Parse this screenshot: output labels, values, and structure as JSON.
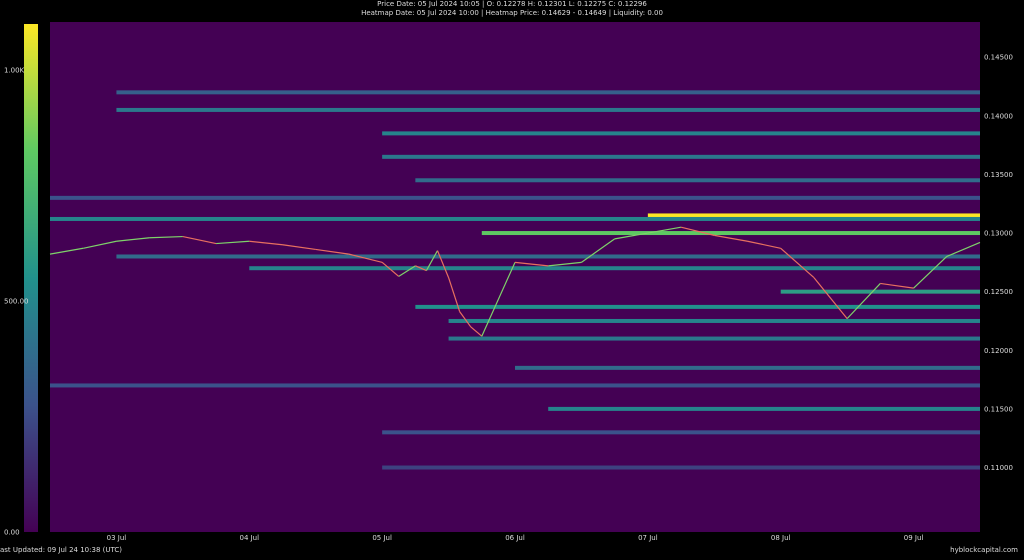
{
  "header": {
    "price_line": "Price Date: 05 Jul 2024 10:05 | O: 0.12278 H: 0.12301 L: 0.12275 C: 0.12296",
    "heatmap_line": "Heatmap Date: 05 Jul 2024 10:00 | Heatmap Price: 0.14629 - 0.14649 | Liquidity: 0.00"
  },
  "footer": {
    "last_updated": "ast Updated: 09 Jul 24 10:38 (UTC)",
    "brand": "hyblockcapital.com"
  },
  "colors": {
    "background": "#000000",
    "heat_low": "#440154",
    "heat_mid": "#21918c",
    "heat_high": "#fde725",
    "price_up": "#7ed36a",
    "price_down": "#e8705f"
  },
  "chart_data": {
    "type": "heatmap",
    "title": "",
    "colorbar": {
      "min": 0,
      "max": 1100,
      "tick_labels": [
        "1.00K",
        "500.00",
        "0.00"
      ],
      "tick_values": [
        1000,
        500,
        0
      ]
    },
    "x_tick_labels": [
      "03 Jul",
      "04 Jul",
      "05 Jul",
      "06 Jul",
      "07 Jul",
      "08 Jul",
      "09 Jul"
    ],
    "x_range": [
      "02 Jul 12:00",
      "09 Jul 12:00"
    ],
    "y_range": [
      0.1045,
      0.148
    ],
    "y_tick_labels": [
      "0.14500",
      "0.14000",
      "0.13500",
      "0.13000",
      "0.12500",
      "0.12000",
      "0.11500",
      "0.11000"
    ],
    "y_tick_values": [
      0.145,
      0.14,
      0.135,
      0.13,
      0.125,
      0.12,
      0.115,
      0.11
    ],
    "price_series": {
      "name": "Price",
      "x": [
        "02 Jul 12:00",
        "02 Jul 18:00",
        "03 Jul 00:00",
        "03 Jul 06:00",
        "03 Jul 12:00",
        "03 Jul 18:00",
        "04 Jul 00:00",
        "04 Jul 06:00",
        "04 Jul 12:00",
        "04 Jul 18:00",
        "05 Jul 00:00",
        "05 Jul 03:00",
        "05 Jul 06:00",
        "05 Jul 08:00",
        "05 Jul 10:00",
        "05 Jul 12:00",
        "05 Jul 14:00",
        "05 Jul 16:00",
        "05 Jul 18:00",
        "06 Jul 00:00",
        "06 Jul 06:00",
        "06 Jul 12:00",
        "06 Jul 18:00",
        "07 Jul 00:00",
        "07 Jul 06:00",
        "07 Jul 12:00",
        "07 Jul 18:00",
        "08 Jul 00:00",
        "08 Jul 06:00",
        "08 Jul 12:00",
        "08 Jul 18:00",
        "09 Jul 00:00",
        "09 Jul 06:00",
        "09 Jul 12:00"
      ],
      "y": [
        0.1282,
        0.1287,
        0.1293,
        0.1296,
        0.1297,
        0.1291,
        0.1293,
        0.129,
        0.1286,
        0.1282,
        0.1275,
        0.1263,
        0.1272,
        0.1268,
        0.1285,
        0.1262,
        0.1233,
        0.122,
        0.1212,
        0.1275,
        0.1272,
        0.1275,
        0.1295,
        0.13,
        0.1305,
        0.1298,
        0.1293,
        0.1287,
        0.1262,
        0.1227,
        0.1257,
        0.1253,
        0.128,
        0.1292
      ]
    },
    "liquidity_bands": [
      {
        "price": 0.142,
        "start": "03 Jul 00:00",
        "level": 0.3
      },
      {
        "price": 0.1405,
        "start": "03 Jul 00:00",
        "level": 0.4
      },
      {
        "price": 0.1385,
        "start": "05 Jul 00:00",
        "level": 0.45
      },
      {
        "price": 0.1365,
        "start": "05 Jul 00:00",
        "level": 0.4
      },
      {
        "price": 0.1345,
        "start": "05 Jul 06:00",
        "level": 0.35
      },
      {
        "price": 0.133,
        "start": "02 Jul 12:00",
        "level": 0.25
      },
      {
        "price": 0.1315,
        "start": "07 Jul 00:00",
        "level": 1.0
      },
      {
        "price": 0.1312,
        "start": "02 Jul 12:00",
        "level": 0.45
      },
      {
        "price": 0.13,
        "start": "05 Jul 18:00",
        "level": 0.75
      },
      {
        "price": 0.128,
        "start": "03 Jul 00:00",
        "level": 0.35
      },
      {
        "price": 0.127,
        "start": "04 Jul 00:00",
        "level": 0.45
      },
      {
        "price": 0.125,
        "start": "08 Jul 00:00",
        "level": 0.55
      },
      {
        "price": 0.1237,
        "start": "05 Jul 06:00",
        "level": 0.5
      },
      {
        "price": 0.1225,
        "start": "05 Jul 12:00",
        "level": 0.45
      },
      {
        "price": 0.121,
        "start": "05 Jul 12:00",
        "level": 0.4
      },
      {
        "price": 0.1185,
        "start": "06 Jul 00:00",
        "level": 0.35
      },
      {
        "price": 0.117,
        "start": "02 Jul 12:00",
        "level": 0.25
      },
      {
        "price": 0.115,
        "start": "06 Jul 06:00",
        "level": 0.45
      },
      {
        "price": 0.113,
        "start": "05 Jul 00:00",
        "level": 0.25
      },
      {
        "price": 0.11,
        "start": "05 Jul 00:00",
        "level": 0.2
      }
    ]
  }
}
